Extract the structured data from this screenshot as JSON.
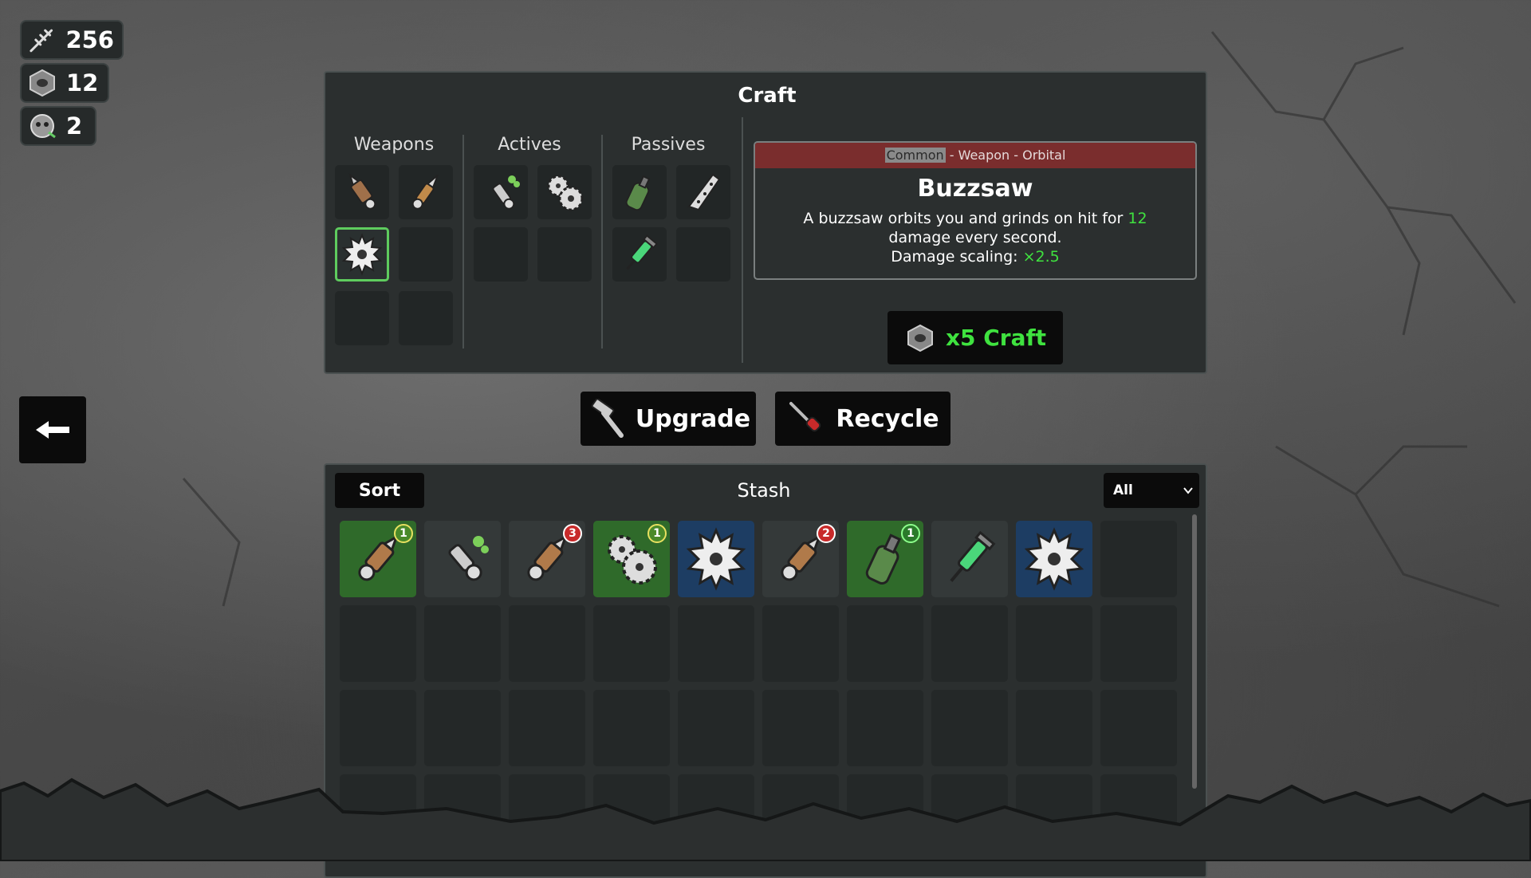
{
  "resources": [
    {
      "icon": "bones-icon",
      "value": "256"
    },
    {
      "icon": "hex-nut-icon",
      "value": "12"
    },
    {
      "icon": "skull-gear-icon",
      "value": "2"
    }
  ],
  "craft": {
    "title": "Craft",
    "columns": {
      "weapons": "Weapons",
      "actives": "Actives",
      "passives": "Passives"
    },
    "card": {
      "rarity": "Common",
      "category": " - Weapon - Orbital",
      "name": "Buzzsaw",
      "desc_a": "A buzzsaw orbits you and grinds on hit for ",
      "desc_num": "12",
      "desc_b": " damage every second.",
      "scaling_label": "Damage scaling: ",
      "scaling_value": "×2.5"
    },
    "craft_button": "x5 Craft"
  },
  "actions": {
    "upgrade": "Upgrade",
    "recycle": "Recycle"
  },
  "stash": {
    "title": "Stash",
    "sort_label": "Sort",
    "filter_value": "All",
    "items": [
      {
        "icon": "drill-weapon-icon",
        "rarity": "green",
        "count": "1"
      },
      {
        "icon": "sprayer-icon",
        "rarity": "none",
        "count": ""
      },
      {
        "icon": "drill-weapon-icon",
        "rarity": "none",
        "count": "3"
      },
      {
        "icon": "gears-icon",
        "rarity": "green",
        "count": "1"
      },
      {
        "icon": "buzzsaw-icon",
        "rarity": "blue",
        "count": ""
      },
      {
        "icon": "drill-weapon-icon",
        "rarity": "none",
        "count": "2"
      },
      {
        "icon": "bottle-icon",
        "rarity": "green",
        "count": "1"
      },
      {
        "icon": "syringe-icon",
        "rarity": "none",
        "count": ""
      },
      {
        "icon": "buzzsaw-icon",
        "rarity": "blue",
        "count": ""
      }
    ]
  },
  "colors": {
    "selected": "#5ecc5e",
    "rarity_common": "#7a2d2d",
    "rarity_green": "#2f6a2a",
    "rarity_blue": "#1d3d63",
    "highlight": "#3fe23f"
  }
}
